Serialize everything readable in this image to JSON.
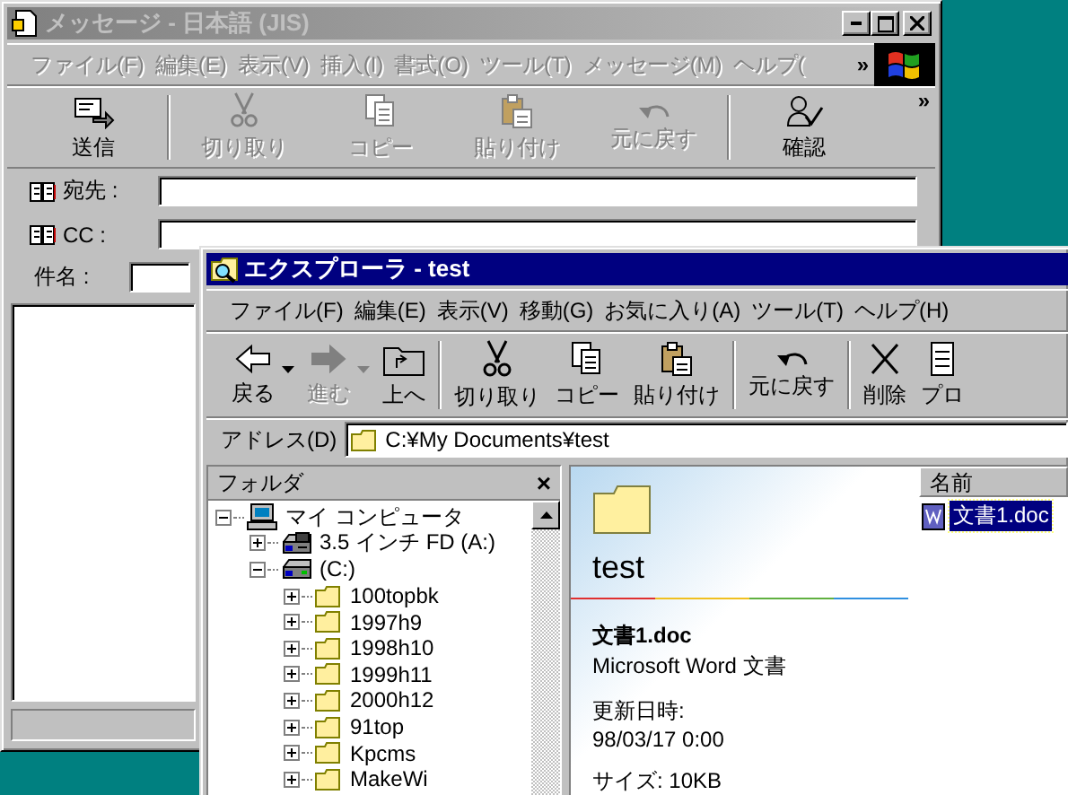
{
  "message_window": {
    "title": "メッセージ - 日本語 (JIS)",
    "active": false,
    "menu": [
      "ファイル(F)",
      "編集(E)",
      "表示(V)",
      "挿入(I)",
      "書式(O)",
      "ツール(T)",
      "メッセージ(M)",
      "ヘルプ("
    ],
    "menu_overflow": "»",
    "toolbar": [
      [
        {
          "label": "送信",
          "kind": "send",
          "disabled": false
        }
      ],
      [
        {
          "label": "切り取り",
          "kind": "cut",
          "disabled": true
        },
        {
          "label": "コピー",
          "kind": "copy",
          "disabled": true
        },
        {
          "label": "貼り付け",
          "kind": "paste",
          "disabled": true
        },
        {
          "label": "元に戻す",
          "kind": "undo",
          "disabled": true
        }
      ],
      [
        {
          "label": "確認",
          "kind": "check",
          "disabled": false
        }
      ]
    ],
    "toolbar_overflow": "»",
    "fields": [
      {
        "label": "宛先 :",
        "kind": "address_book"
      },
      {
        "label": "CC :",
        "kind": "address_book"
      },
      {
        "label": "件名 :",
        "kind": "plain"
      }
    ]
  },
  "explorer_window": {
    "title": "エクスプローラ - test",
    "active": true,
    "menu": [
      "ファイル(F)",
      "編集(E)",
      "表示(V)",
      "移動(G)",
      "お気に入り(A)",
      "ツール(T)",
      "ヘルプ(H)"
    ],
    "toolbar": [
      [
        {
          "label": "戻る",
          "kind": "back",
          "disabled": false,
          "dropdown": true
        },
        {
          "label": "進む",
          "kind": "forward",
          "disabled": true,
          "dropdown": true
        },
        {
          "label": "上へ",
          "kind": "up",
          "disabled": false,
          "dropdown": false
        }
      ],
      [
        {
          "label": "切り取り",
          "kind": "cut",
          "disabled": false,
          "dropdown": false
        },
        {
          "label": "コピー",
          "kind": "copy",
          "disabled": false,
          "dropdown": false
        },
        {
          "label": "貼り付け",
          "kind": "paste",
          "disabled": false,
          "dropdown": false
        }
      ],
      [
        {
          "label": "元に戻す",
          "kind": "undo",
          "disabled": false,
          "dropdown": false
        }
      ],
      [
        {
          "label": "削除",
          "kind": "delete",
          "disabled": false,
          "dropdown": false
        },
        {
          "label": "プロ",
          "kind": "properties",
          "disabled": false,
          "dropdown": false
        }
      ]
    ],
    "address": {
      "label": "アドレス(D)",
      "value": "C:¥My Documents¥test"
    },
    "folder_pane": {
      "title": "フォルダ",
      "close": "×",
      "tree": [
        {
          "label": "マイ コンピュータ",
          "kind": "computer",
          "expanded": true,
          "children": [
            {
              "label": "3.5 インチ FD (A:)",
              "kind": "floppy",
              "expanded": false
            },
            {
              "label": "(C:)",
              "kind": "drive",
              "expanded": true,
              "children": [
                {
                  "label": "100topbk",
                  "kind": "folder",
                  "expanded": false
                },
                {
                  "label": "1997h9",
                  "kind": "folder",
                  "expanded": false
                },
                {
                  "label": "1998h10",
                  "kind": "folder",
                  "expanded": false
                },
                {
                  "label": "1999h11",
                  "kind": "folder",
                  "expanded": false
                },
                {
                  "label": "2000h12",
                  "kind": "folder",
                  "expanded": false
                },
                {
                  "label": "91top",
                  "kind": "folder",
                  "expanded": false
                },
                {
                  "label": "Kpcms",
                  "kind": "folder",
                  "expanded": false
                },
                {
                  "label": "MakeWi",
                  "kind": "folder",
                  "expanded": false
                }
              ]
            }
          ]
        }
      ]
    },
    "web_view": {
      "title": "test",
      "file_name": "文書1.doc",
      "file_type": "Microsoft Word 文書",
      "modified_label": "更新日時:",
      "modified_value": "98/03/17 0:00",
      "size": "サイズ: 10KB"
    },
    "file_list": {
      "columns": [
        "名前"
      ],
      "items": [
        {
          "name": "文書1.doc",
          "selected": true
        }
      ]
    }
  }
}
